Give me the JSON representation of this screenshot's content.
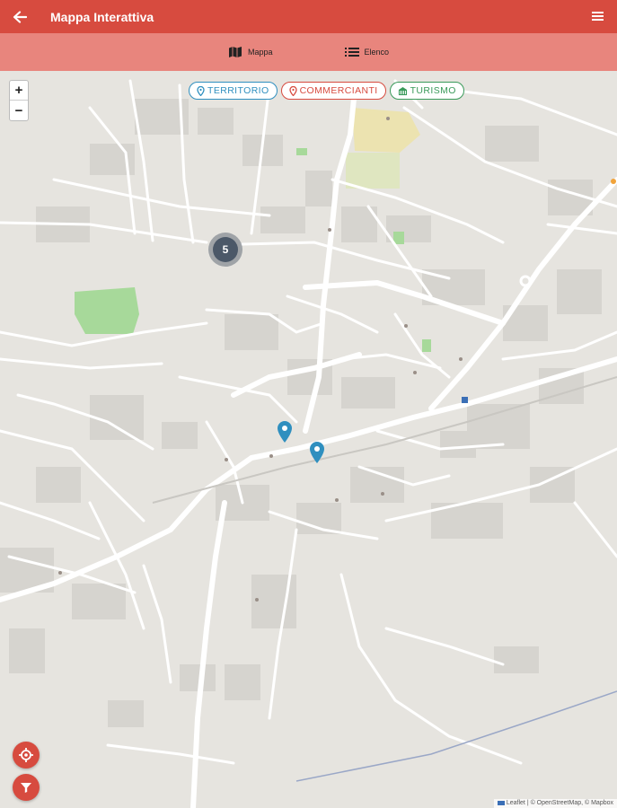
{
  "header": {
    "title": "Mappa Interattiva",
    "back_icon": "arrow-left-icon",
    "menu_icon": "hamburger-menu-icon",
    "color": "#d74b3f"
  },
  "tabs": [
    {
      "label": "Mappa",
      "icon": "map-icon",
      "active": true
    },
    {
      "label": "Elenco",
      "icon": "list-icon",
      "active": false
    }
  ],
  "tabbar_color": "#e8857d",
  "zoom": {
    "in_label": "+",
    "out_label": "−"
  },
  "filters": [
    {
      "label": "TERRITORIO",
      "icon": "map-pin-icon",
      "color": "#2f8fbf"
    },
    {
      "label": "COMMERCIANTI",
      "icon": "map-pin-icon",
      "color": "#d74b3f"
    },
    {
      "label": "TURISMO",
      "icon": "museum-icon",
      "color": "#3a9a5a"
    }
  ],
  "cluster": {
    "count": "5"
  },
  "attribution": "Leaflet | © OpenStreetMap, © Mapbox"
}
